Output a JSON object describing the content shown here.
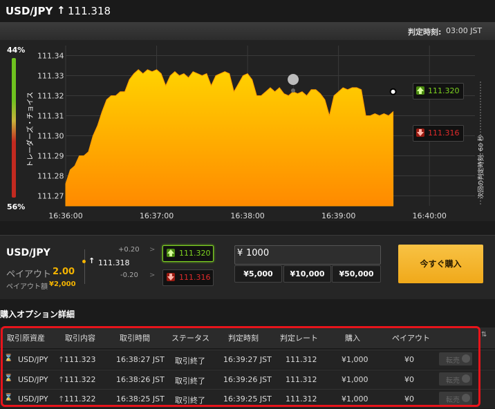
{
  "header": {
    "symbol": "USD/JPY",
    "arrow": "↑",
    "price": "111.318"
  },
  "subbar": {
    "judge_label": "判定時刻:",
    "judge_time": "03:00 JST"
  },
  "trader_choice": {
    "label": "トレーダーズ・チョイス",
    "top_pct": "44%",
    "bottom_pct": "56%"
  },
  "chart": {
    "y_ticks": [
      "111.34",
      "111.33",
      "111.32",
      "111.31",
      "111.30",
      "111.29",
      "111.28",
      "111.27"
    ],
    "x_ticks": [
      "16:36:00",
      "16:37:00",
      "16:38:00",
      "16:39:00",
      "16:40:00"
    ],
    "rate_up": "111.320",
    "rate_down": "111.316",
    "next_judge": "次回の判定時刻: 60 秒"
  },
  "chart_data": {
    "type": "area",
    "ylim": [
      111.265,
      111.345
    ],
    "x_range_minutes": [
      0,
      4.5
    ],
    "x_labels": [
      "16:36:00",
      "16:37:00",
      "16:38:00",
      "16:39:00",
      "16:40:00"
    ],
    "points": [
      [
        0.0,
        111.276
      ],
      [
        0.05,
        111.283
      ],
      [
        0.1,
        111.285
      ],
      [
        0.15,
        111.29
      ],
      [
        0.2,
        111.29
      ],
      [
        0.25,
        111.292
      ],
      [
        0.3,
        111.3
      ],
      [
        0.35,
        111.305
      ],
      [
        0.4,
        111.312
      ],
      [
        0.45,
        111.318
      ],
      [
        0.5,
        111.32
      ],
      [
        0.55,
        111.32
      ],
      [
        0.6,
        111.322
      ],
      [
        0.65,
        111.322
      ],
      [
        0.7,
        111.328
      ],
      [
        0.75,
        111.331
      ],
      [
        0.8,
        111.333
      ],
      [
        0.85,
        111.331
      ],
      [
        0.9,
        111.333
      ],
      [
        0.95,
        111.332
      ],
      [
        1.0,
        111.333
      ],
      [
        1.05,
        111.331
      ],
      [
        1.1,
        111.325
      ],
      [
        1.15,
        111.33
      ],
      [
        1.2,
        111.332
      ],
      [
        1.25,
        111.33
      ],
      [
        1.3,
        111.331
      ],
      [
        1.35,
        111.329
      ],
      [
        1.4,
        111.332
      ],
      [
        1.45,
        111.331
      ],
      [
        1.5,
        111.33
      ],
      [
        1.55,
        111.331
      ],
      [
        1.6,
        111.325
      ],
      [
        1.65,
        111.33
      ],
      [
        1.7,
        111.331
      ],
      [
        1.75,
        111.332
      ],
      [
        1.8,
        111.331
      ],
      [
        1.85,
        111.322
      ],
      [
        1.9,
        111.326
      ],
      [
        1.95,
        111.33
      ],
      [
        2.0,
        111.331
      ],
      [
        2.05,
        111.328
      ],
      [
        2.1,
        111.32
      ],
      [
        2.15,
        111.32
      ],
      [
        2.2,
        111.322
      ],
      [
        2.25,
        111.324
      ],
      [
        2.3,
        111.322
      ],
      [
        2.35,
        111.324
      ],
      [
        2.4,
        111.321
      ],
      [
        2.45,
        111.32
      ],
      [
        2.5,
        111.322
      ],
      [
        2.55,
        111.321
      ],
      [
        2.6,
        111.322
      ],
      [
        2.65,
        111.32
      ],
      [
        2.7,
        111.323
      ],
      [
        2.75,
        111.323
      ],
      [
        2.8,
        111.321
      ],
      [
        2.85,
        111.318
      ],
      [
        2.9,
        111.31
      ],
      [
        2.95,
        111.32
      ],
      [
        3.0,
        111.322
      ],
      [
        3.05,
        111.324
      ],
      [
        3.1,
        111.323
      ],
      [
        3.15,
        111.324
      ],
      [
        3.2,
        111.324
      ],
      [
        3.25,
        111.323
      ],
      [
        3.3,
        111.31
      ],
      [
        3.35,
        111.31
      ],
      [
        3.4,
        111.311
      ],
      [
        3.45,
        111.31
      ],
      [
        3.5,
        111.311
      ],
      [
        3.55,
        111.31
      ],
      [
        3.6,
        111.312
      ]
    ]
  },
  "trade": {
    "symbol": "USD/JPY",
    "payout_label": "ペイアウト",
    "payout_value": "2.00",
    "payout_amt_label": "ペイアウト額",
    "payout_amt": "¥2,000",
    "plus_range": "+0.20",
    "minus_range": "-0.20",
    "gt": ">",
    "arrow": "↑",
    "price": "111.318",
    "up_rate": "111.320",
    "down_rate": "111.316",
    "amount_yen": "¥",
    "amount": "1000",
    "amounts": [
      "¥5,000",
      "¥10,000",
      "¥50,000"
    ],
    "buy_label": "今すぐ購入"
  },
  "details": {
    "title": "購入オプション詳細",
    "headers": [
      "取引原資産",
      "取引内容",
      "取引時間",
      "ステータス",
      "判定時刻",
      "判定レート",
      "購入",
      "ペイアウト"
    ],
    "rows": [
      {
        "asset": "USD/JPY",
        "arrow": "↑",
        "rate": "111.323",
        "time": "16:38:27 JST",
        "status": "取引終了",
        "judge": "16:39:27 JST",
        "judge_rate": "111.312",
        "buy": "¥1,000",
        "payout": "¥0",
        "sell": "転売"
      },
      {
        "asset": "USD/JPY",
        "arrow": "↑",
        "rate": "111.322",
        "time": "16:38:26 JST",
        "status": "取引終了",
        "judge": "16:39:26 JST",
        "judge_rate": "111.312",
        "buy": "¥1,000",
        "payout": "¥0",
        "sell": "転売"
      },
      {
        "asset": "USD/JPY",
        "arrow": "↑",
        "rate": "111.322",
        "time": "16:38:25 JST",
        "status": "取引終了",
        "judge": "16:39:25 JST",
        "judge_rate": "111.312",
        "buy": "¥1,000",
        "payout": "¥0",
        "sell": "転売"
      }
    ]
  },
  "colors": {
    "accent": "#f5b400",
    "up": "#7ed321",
    "down": "#e02b2b",
    "highlight": "#e8141b"
  }
}
